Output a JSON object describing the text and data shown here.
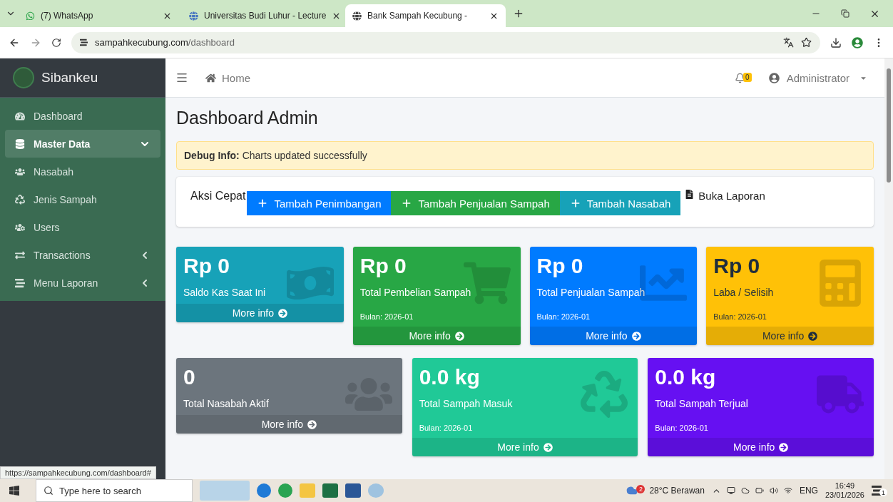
{
  "browser": {
    "tabs": [
      {
        "title": "(7) WhatsApp",
        "selected": false
      },
      {
        "title": "Universitas Budi Luhur - Lecture",
        "selected": false
      },
      {
        "title": "Bank Sampah Kecubung -",
        "selected": true
      }
    ],
    "address": {
      "host": "sampahkecubung.com",
      "path": "/dashboard"
    }
  },
  "sidebar": {
    "brand": "Sibankeu",
    "items": [
      {
        "label": "Dashboard",
        "selected": false
      },
      {
        "label": "Master Data",
        "selected": true,
        "expanded": true,
        "children": [
          {
            "label": "Nasabah",
            "selected": false
          },
          {
            "label": "Jenis Sampah",
            "selected": false
          },
          {
            "label": "Users",
            "selected": false
          }
        ]
      },
      {
        "label": "Transactions",
        "selected": false,
        "expanded": false
      },
      {
        "label": "Menu Laporan",
        "selected": false,
        "expanded": false
      }
    ]
  },
  "header": {
    "breadcrumb": "Home",
    "notifications": "0",
    "user": "Administrator"
  },
  "page_title": "Dashboard Admin",
  "alert": {
    "label": "Debug Info:",
    "message": "Charts updated successfully"
  },
  "quick_actions": {
    "label": "Aksi Cepat",
    "buttons": [
      {
        "label": "Tambah Penimbangan",
        "color": "#007bff"
      },
      {
        "label": "Tambah Penjualan Sampah",
        "color": "#28a745"
      },
      {
        "label": "Tambah Nasabah",
        "color": "#17a2b8"
      }
    ],
    "link": "Buka Laporan"
  },
  "stat_rows": [
    {
      "cards": [
        {
          "value": "Rp 0",
          "label": "Saldo Kas Saat Ini",
          "footer": "More info",
          "color": "#17a2b8"
        },
        {
          "value": "Rp 0",
          "label": "Total Pembelian Sampah",
          "period": "Bulan: 2026-01",
          "footer": "More info",
          "color": "#28a745"
        },
        {
          "value": "Rp 0",
          "label": "Total Penjualan Sampah",
          "period": "Bulan: 2026-01",
          "footer": "More info",
          "color": "#007bff"
        },
        {
          "value": "Rp 0",
          "label": "Laba / Selisih",
          "period": "Bulan: 2026-01",
          "footer": "More info",
          "color": "#ffc107"
        }
      ]
    },
    {
      "cards": [
        {
          "value": "0",
          "label": "Total Nasabah Aktif",
          "footer": "More info",
          "color": "#6c757d"
        },
        {
          "value": "0.0 kg",
          "label": "Total Sampah Masuk",
          "period": "Bulan: 2026-01",
          "footer": "More info",
          "color": "#20c997"
        },
        {
          "value": "0.0 kg",
          "label": "Total Sampah Terjual",
          "period": "Bulan: 2026-01",
          "footer": "More info",
          "color": "#6610f2"
        }
      ]
    }
  ],
  "status_url": "https://sampahkecubung.com/dashboard#",
  "taskbar": {
    "search_placeholder": "Type here to search",
    "weather": "28°C Berawan",
    "weather_badge": "2",
    "language": "ENG",
    "time": "16:49",
    "date": "23/01/2026",
    "notification_count": "1"
  }
}
